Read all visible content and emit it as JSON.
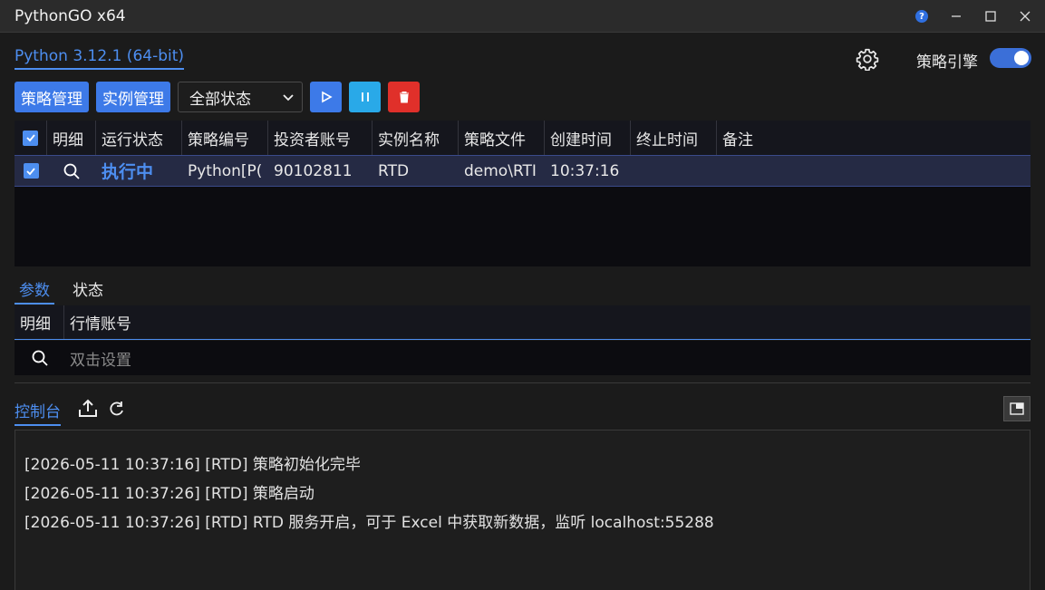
{
  "window": {
    "title": "PythonGO x64",
    "help_glyph": "?",
    "icons": [
      "help-icon",
      "minimize-icon",
      "maximize-icon",
      "close-icon"
    ]
  },
  "header": {
    "python_version": "Python 3.12.1 (64-bit)",
    "engine_label": "策略引擎",
    "engine_on": true
  },
  "toolbar": {
    "strategy_mgmt": "策略管理",
    "instance_mgmt": "实例管理",
    "status_filter": "全部状态",
    "icons": [
      "play-icon",
      "pause-icon",
      "delete-icon"
    ]
  },
  "table": {
    "columns": [
      "明细",
      "运行状态",
      "策略编号",
      "投资者账号",
      "实例名称",
      "策略文件",
      "创建时间",
      "终止时间",
      "备注"
    ],
    "rows": [
      {
        "checked": true,
        "status": "执行中",
        "strategy_id": "Python[P(",
        "account": "90102811",
        "instance": "RTD",
        "file": "demo\\RTI",
        "created": "10:37:16",
        "ended": "",
        "note": ""
      }
    ]
  },
  "params": {
    "tabs": [
      "参数",
      "状态"
    ],
    "columns": [
      "明细",
      "行情账号"
    ],
    "placeholder": "双击设置"
  },
  "console": {
    "tab": "控制台",
    "lines": [
      "[2026-05-11 10:37:16] [RTD] 策略初始化完毕",
      "[2026-05-11 10:37:26] [RTD] 策略启动",
      "[2026-05-11 10:37:26] [RTD] RTD 服务开启，可于 Excel 中获取新数据，监听 localhost:55288"
    ]
  },
  "colors": {
    "accent": "#4d8ef0",
    "running": "#4d8ef0",
    "delete": "#e0302a",
    "pause": "#29a9e8"
  }
}
